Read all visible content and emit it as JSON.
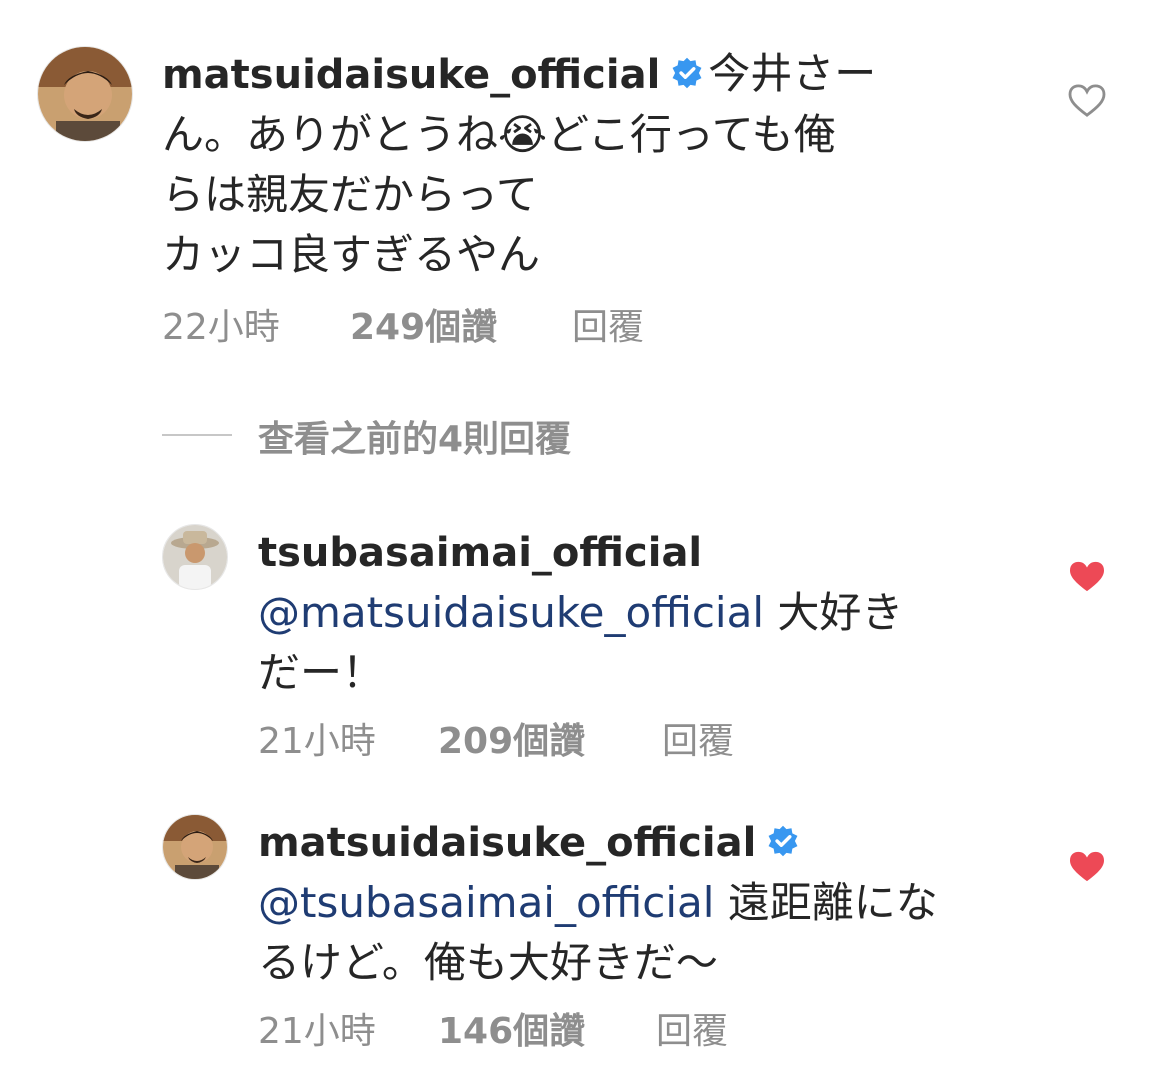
{
  "main_comment": {
    "username": "matsuidaisuke_official",
    "verified": true,
    "text_lines": [
      "今井さー",
      "ん。ありがとうね😭どこ行っても俺",
      "らは親友だからって",
      "カッコ良すぎるやん"
    ],
    "time": "22小時",
    "likes": "249個讚",
    "reply_label": "回覆",
    "liked": false
  },
  "view_replies": {
    "label": "查看之前的4則回覆"
  },
  "replies": [
    {
      "username": "tsubasaimai_official",
      "verified": false,
      "mention": "@matsuidaisuke_official",
      "text_first": " 大好き",
      "text_lines": [
        "だー！"
      ],
      "time": "21小時",
      "likes": "209個讚",
      "reply_label": "回覆",
      "liked": true
    },
    {
      "username": "matsuidaisuke_official",
      "verified": true,
      "mention": "@tsubasaimai_official",
      "text_first": " 遠距離にな",
      "text_lines": [
        "るけど。俺も大好きだ〜"
      ],
      "time": "21小時",
      "likes": "146個讚",
      "reply_label": "回覆",
      "liked": true
    }
  ],
  "colors": {
    "text": "#262626",
    "secondary": "#8e8e8e",
    "mention": "#1f3c73",
    "verified_badge": "#3897f0",
    "heart_liked": "#ed4956",
    "heart_outline": "#8e8e8e"
  },
  "icons": {
    "verified": "verified-badge-icon",
    "heart_outline": "heart-outline-icon",
    "heart_filled": "heart-filled-icon"
  }
}
